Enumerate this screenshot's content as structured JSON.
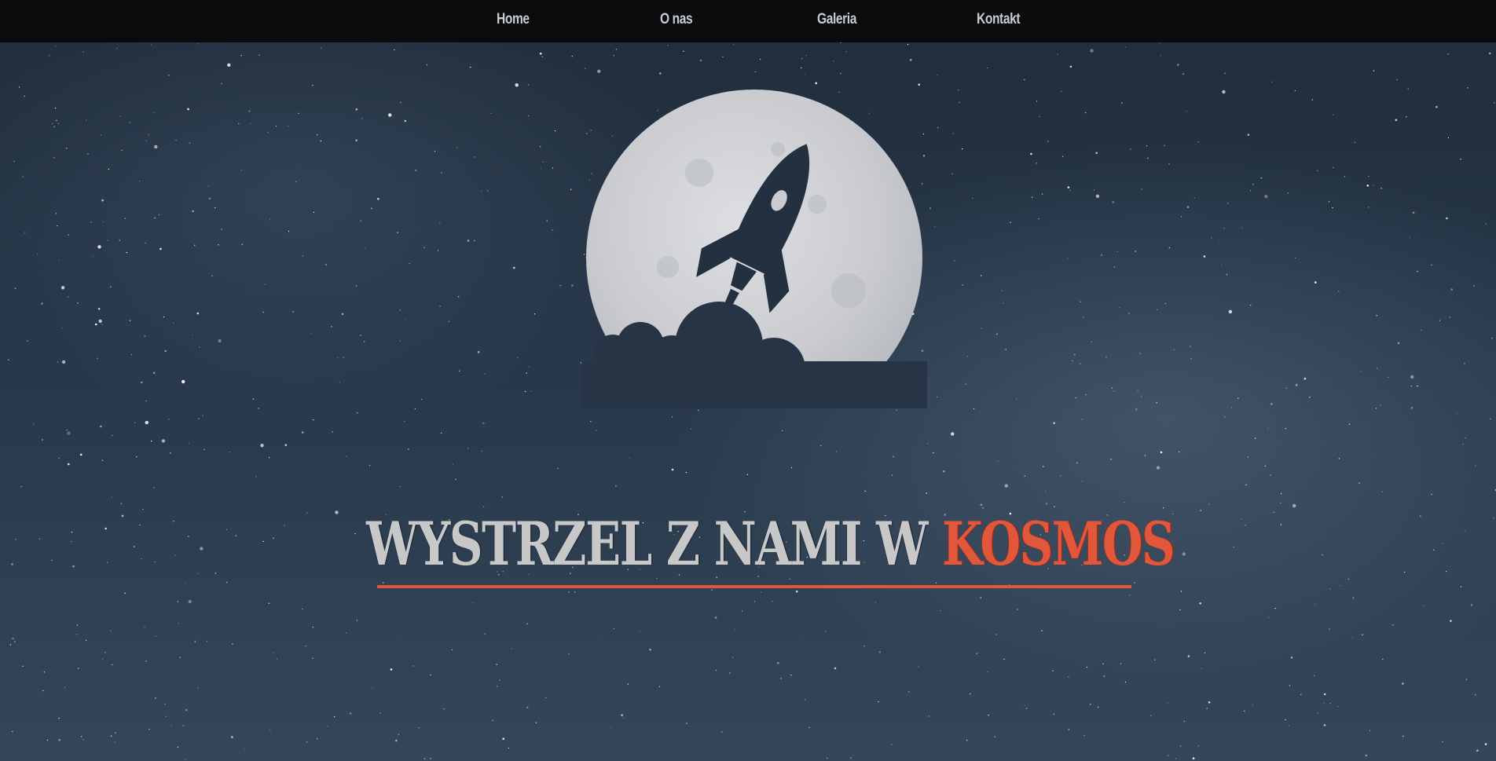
{
  "nav": {
    "items": [
      {
        "label": "Home"
      },
      {
        "label": "O nas"
      },
      {
        "label": "Galeria"
      },
      {
        "label": "Kontakt"
      }
    ]
  },
  "hero": {
    "headline_main": "WYSTRZEL Z NAMI W ",
    "headline_accent": "KOSMOS"
  },
  "logo": {
    "icon": "rocket-moon-logo"
  },
  "colors": {
    "accent": "#e0573c",
    "moon": "#d3d5d8",
    "sky": "#273749",
    "nav_bg": "#08090a",
    "nav_text": "#c9ccd0"
  }
}
